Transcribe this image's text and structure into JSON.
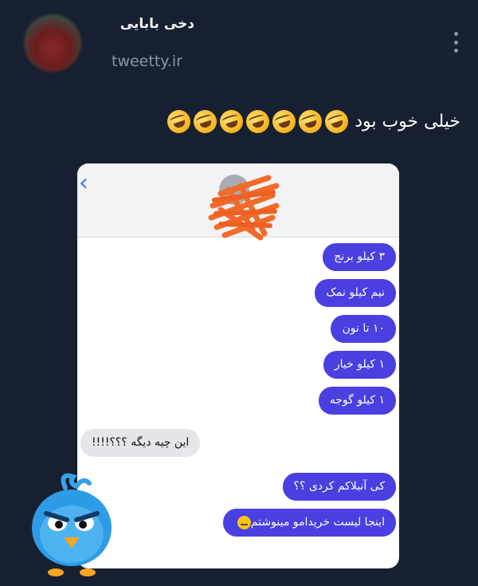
{
  "author": {
    "name": "دخی بابایی",
    "handle": "tweetty.ir",
    "avatar_icon": "profile-avatar"
  },
  "menu": {
    "icon": "more-vertical-icon"
  },
  "tweet": {
    "text": "خیلی خوب بود",
    "emoji_icon": "rolling-on-floor-laughing-emoji",
    "emoji_count": 7
  },
  "screenshot": {
    "back_icon": "chevron-left-icon",
    "messages": [
      {
        "type": "sent",
        "text": "۳ کیلو برنج"
      },
      {
        "type": "sent",
        "text": "نیم کیلو نمک"
      },
      {
        "type": "sent",
        "text": "۱۰ تا نون"
      },
      {
        "type": "sent",
        "text": "۱ کیلو خیار"
      },
      {
        "type": "sent",
        "text": "۱ کیلو گوجه"
      },
      {
        "type": "received",
        "text": "این چیه دیگه ؟؟؟!!!!"
      },
      {
        "type": "sent",
        "text": "کی آنبلاکم کردی ؟؟"
      },
      {
        "type": "sent",
        "text": "اینجا لیست خریدامو مینوشتم",
        "emoji_icon": "neutral-face-emoji"
      }
    ],
    "colors": {
      "sent": "#4a3fe0",
      "received": "#e6e6ea"
    }
  },
  "mascot": {
    "icon": "angry-blue-bird-icon"
  }
}
